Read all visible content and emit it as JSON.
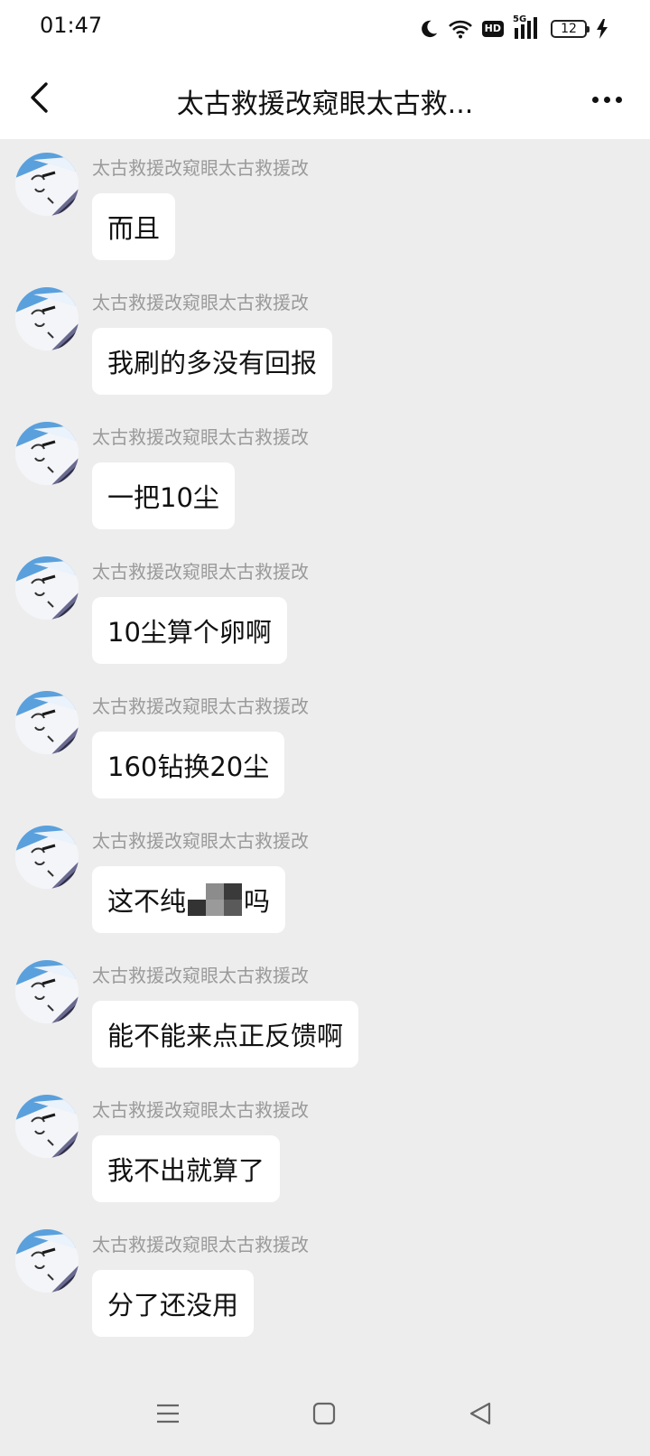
{
  "status_bar": {
    "time": "01:47",
    "network_label": "5G",
    "hd_label": "HD",
    "battery_level": "12",
    "icons": [
      "moon-icon",
      "wifi-icon",
      "hd-icon",
      "signal-icon",
      "battery-icon",
      "charging-icon"
    ]
  },
  "header": {
    "title": "太古救援改窥眼太古救...",
    "back_icon": "chevron-left-icon",
    "more_icon": "more-horizontal-icon"
  },
  "messages": [
    {
      "sender": "太古救援改窥眼太古救援改",
      "text": "而且"
    },
    {
      "sender": "太古救援改窥眼太古救援改",
      "text": "我刷的多没有回报"
    },
    {
      "sender": "太古救援改窥眼太古救援改",
      "text": "一把10尘"
    },
    {
      "sender": "太古救援改窥眼太古救援改",
      "text": "10尘算个卵啊"
    },
    {
      "sender": "太古救援改窥眼太古救援改",
      "text": "160钻换20尘"
    },
    {
      "sender": "太古救援改窥眼太古救援改",
      "text_before": "这不纯",
      "text_after": "吗"
    },
    {
      "sender": "太古救援改窥眼太古救援改",
      "text": "能不能来点正反馈啊"
    },
    {
      "sender": "太古救援改窥眼太古救援改",
      "text": "我不出就算了"
    },
    {
      "sender": "太古救援改窥眼太古救援改",
      "text": "分了还没用"
    }
  ],
  "nav_bar": {
    "icons": [
      "menu-icon",
      "home-square-icon",
      "back-triangle-icon"
    ]
  },
  "colors": {
    "background": "#ededed",
    "bubble": "#ffffff",
    "sender_text": "#9a9a9a",
    "avatar_sky": "#5aa0dc",
    "avatar_shadow": "#6a6a90"
  }
}
